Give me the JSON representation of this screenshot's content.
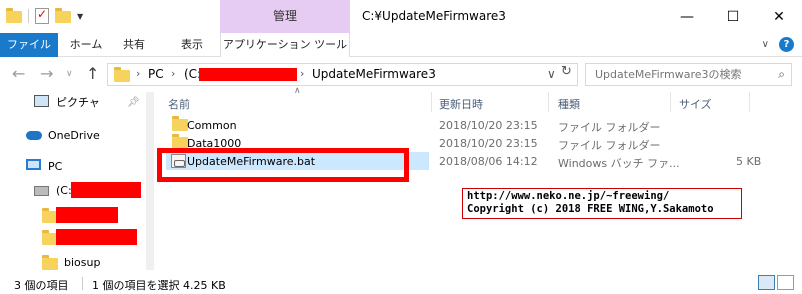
{
  "titlebar": {
    "context_tab": "管理",
    "title": "C:¥UpdateMeFirmware3",
    "minimize": "—",
    "maximize": "☐",
    "close": "✕"
  },
  "ribbon": {
    "tabs": [
      "ファイル",
      "ホーム",
      "共有",
      "表示",
      "アプリケーション ツール"
    ],
    "expand_icon": "chevron-down-icon",
    "help_icon": "help-icon"
  },
  "address": {
    "path": [
      "PC",
      "(C:",
      "UpdateMeFirmware3"
    ],
    "search_placeholder": "UpdateMeFirmware3の検索"
  },
  "nav": {
    "items": [
      {
        "label": "ピクチャ",
        "icon": "pictures-icon"
      },
      {
        "label": "OneDrive",
        "icon": "onedrive-icon"
      },
      {
        "label": "PC",
        "icon": "pc-icon"
      },
      {
        "label": "(C:)",
        "icon": "drive-icon"
      },
      {
        "label": "",
        "icon": "folder-icon"
      },
      {
        "label": "",
        "icon": "folder-icon"
      },
      {
        "label": "biosup",
        "icon": "folder-icon"
      }
    ]
  },
  "columns": {
    "name": "名前",
    "date": "更新日時",
    "type": "種類",
    "size": "サイズ"
  },
  "files": [
    {
      "name": "Common",
      "date": "2018/10/20 23:15",
      "type": "ファイル フォルダー",
      "size": "",
      "icon": "folder-icon"
    },
    {
      "name": "Data1000",
      "date": "2018/10/20 23:15",
      "type": "ファイル フォルダー",
      "size": "",
      "icon": "folder-icon"
    },
    {
      "name": "UpdateMeFirmware.bat",
      "date": "2018/08/06 14:12",
      "type": "Windows バッチ ファ...",
      "size": "5 KB",
      "icon": "batch-file-icon"
    }
  ],
  "credit": {
    "line1": "http://www.neko.ne.jp/~freewing/",
    "line2": "Copyright (c) 2018 FREE WING,Y.Sakamoto"
  },
  "status": {
    "items": "3 個の項目",
    "selected": "1 個の項目を選択 4.25 KB"
  },
  "colors": {
    "file_tab": "#1979ca",
    "context_tab": "#e6ccf2",
    "selection": "#cce8ff",
    "highlight_box": "#ff0000"
  }
}
